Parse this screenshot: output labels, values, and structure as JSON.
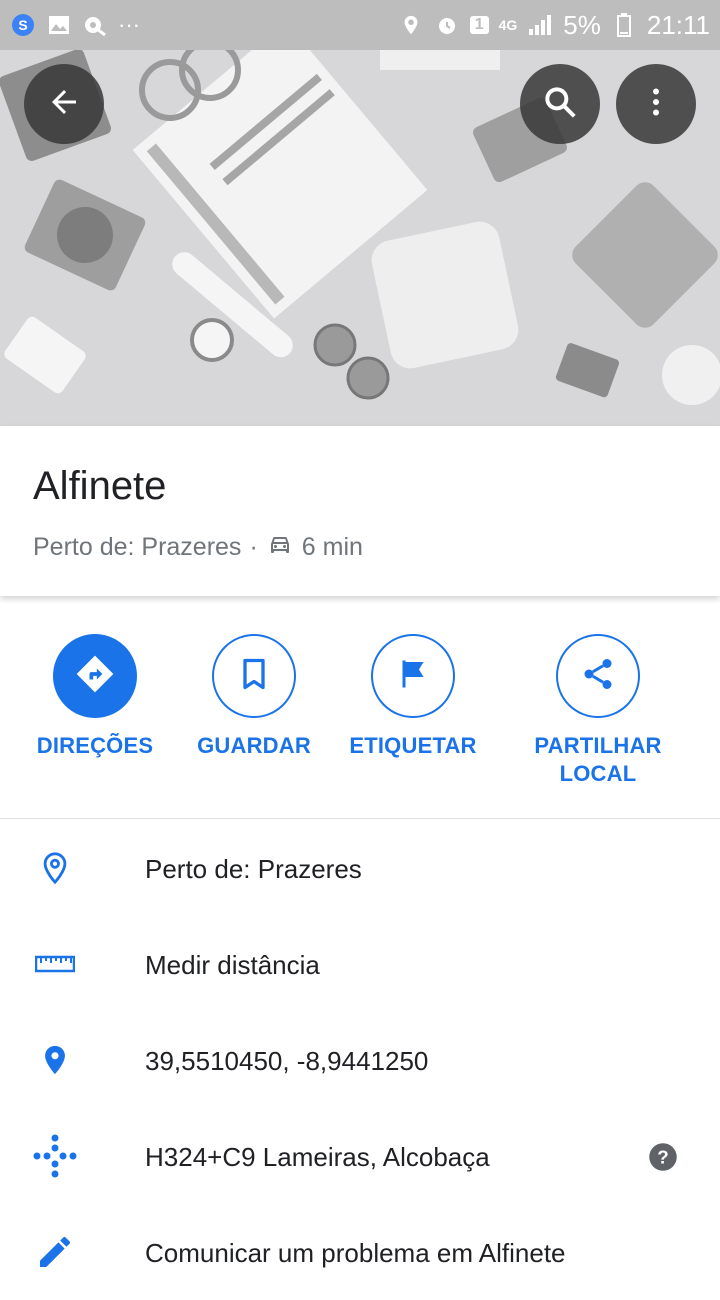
{
  "status_bar": {
    "network": "4G",
    "sim": "1",
    "battery": "5%",
    "time": "21:11",
    "dots": "···"
  },
  "header": {
    "back": "arrow-back-icon",
    "search": "search-icon",
    "menu": "more-vert-icon"
  },
  "place": {
    "title": "Alfinete",
    "near": "Perto de: Prazeres",
    "separator": "·",
    "drive_time": "6 min"
  },
  "actions": [
    {
      "label": "DIREÇÕES"
    },
    {
      "label": "GUARDAR"
    },
    {
      "label": "ETIQUETAR"
    },
    {
      "label": "PARTILHAR\nLOCAL"
    }
  ],
  "details": [
    {
      "icon": "pin-outline-icon",
      "text": "Perto de: Prazeres"
    },
    {
      "icon": "ruler-icon",
      "text": "Medir distância"
    },
    {
      "icon": "pin-filled-icon",
      "text": "39,5510450, -8,9441250"
    },
    {
      "icon": "plus-code-icon",
      "text": "H324+C9 Lameiras, Alcobaça"
    },
    {
      "icon": "pencil-icon",
      "text": "Comunicar um problema em Alfinete"
    }
  ],
  "colors": {
    "accent": "#1a73e8",
    "status_bar": "#bdbdbd",
    "hero_bg": "#d7d7d9"
  }
}
